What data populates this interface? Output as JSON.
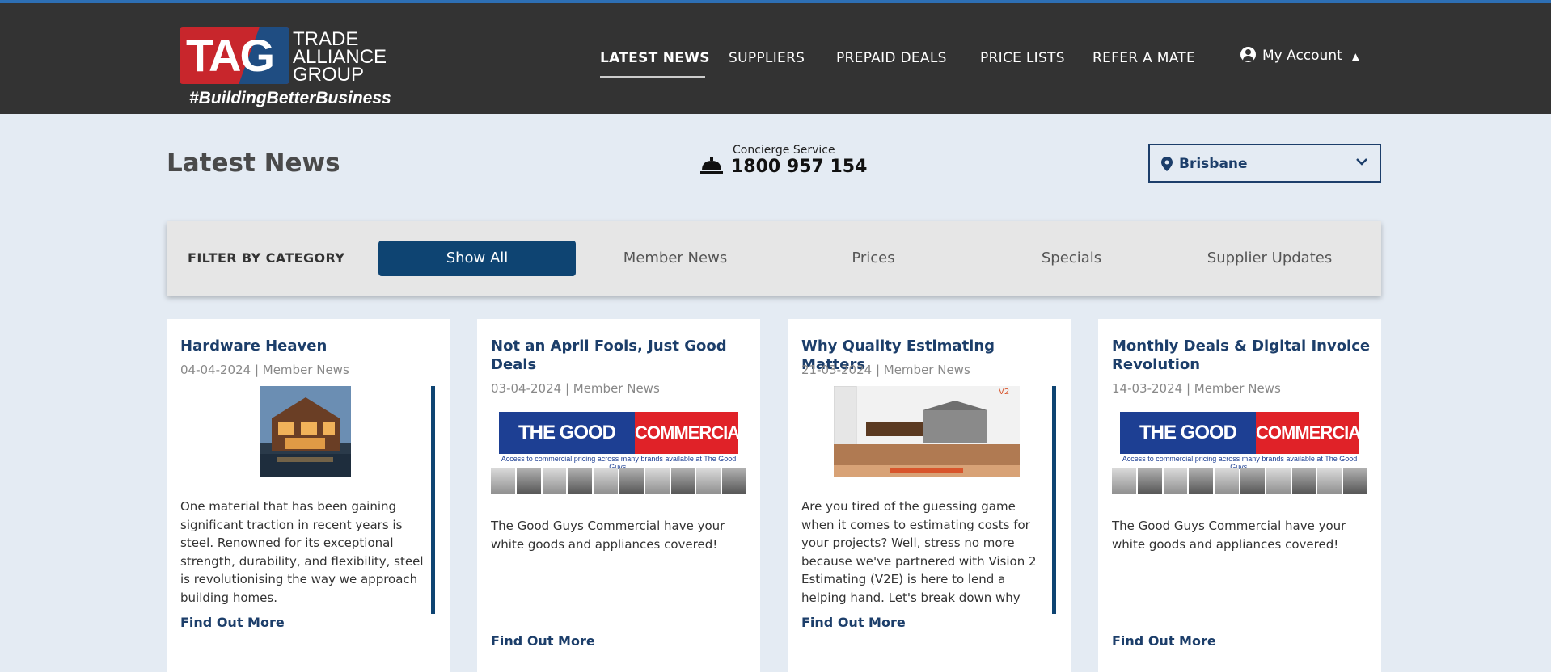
{
  "brand": {
    "logo_text": "TAG",
    "logo_lines": [
      "TRADE",
      "ALLIANCE",
      "GROUP"
    ],
    "hashtag": "#BuildingBetterBusiness",
    "colors": {
      "header": "#333333",
      "accent_blue": "#0e4472",
      "link": "#1c3e6a",
      "logo_red": "#c8262c"
    }
  },
  "nav": {
    "items": [
      {
        "label": "LATEST NEWS",
        "active": true
      },
      {
        "label": "SUPPLIERS"
      },
      {
        "label": "PREPAID DEALS"
      },
      {
        "label": "PRICE LISTS"
      },
      {
        "label": "REFER A MATE"
      }
    ],
    "account_label": "My Account"
  },
  "page": {
    "title": "Latest News",
    "concierge_label": "Concierge Service",
    "concierge_phone": "1800 957 154",
    "location": "Brisbane"
  },
  "filter": {
    "label": "FILTER BY CATEGORY",
    "options": [
      "Show All",
      "Member News",
      "Prices",
      "Specials",
      "Supplier Updates"
    ],
    "selected": "Show All"
  },
  "cards": [
    {
      "title": "Hardware Heaven",
      "meta": "04-04-2024 | Member News",
      "excerpt": "One material that has been gaining significant traction in recent years is steel. Renowned for its exceptional strength, durability, and flexibility, steel is revolutionising the way we approach building homes.",
      "cta": "Find Out More"
    },
    {
      "title": "Not an April Fools, Just Good Deals",
      "meta": "03-04-2024 | Member News",
      "excerpt": "The Good Guys Commercial have your white goods and appliances covered!",
      "cta": "Find Out More",
      "banner": {
        "left": "THE GOOD GUYS",
        "right": "COMMERCIAL",
        "sub": "Access to commercial pricing across many brands available at The Good Guys."
      }
    },
    {
      "title": "Why Quality Estimating Matters",
      "meta": "21-03-2024 | Member News",
      "excerpt": "Are you tired of the guessing game when it comes to estimating costs for your projects? Well, stress no more because we've partnered with Vision 2 Estimating (V2E) is here to lend a helping hand. Let's break down why quality estimating is crucial and how",
      "cta": "Find Out More"
    },
    {
      "title": "Monthly Deals & Digital Invoice Revolution",
      "meta": "14-03-2024 | Member News",
      "excerpt": "The Good Guys Commercial have your white goods and appliances covered!",
      "cta": "Find Out More",
      "banner": {
        "left": "THE GOOD GUYS",
        "right": "COMMERCIAL",
        "sub": "Access to commercial pricing across many brands available at The Good Guys."
      }
    }
  ]
}
